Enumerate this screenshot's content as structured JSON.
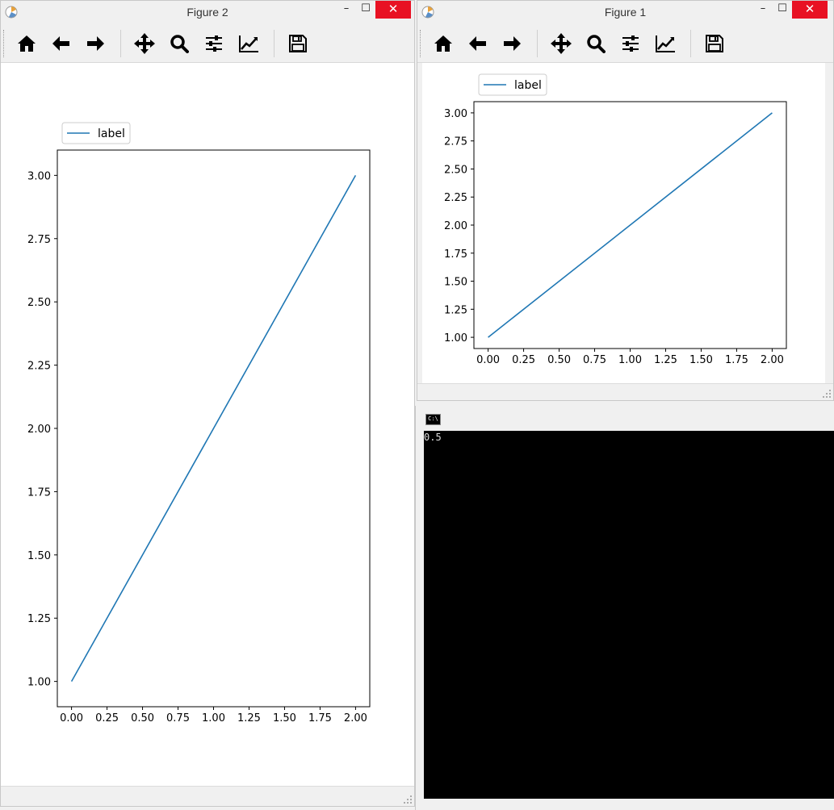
{
  "windows": {
    "figure2": {
      "title": "Figure 2",
      "minimize": "–",
      "maximize": "☐",
      "close": "✕",
      "legend_label": "label"
    },
    "figure1": {
      "title": "Figure 1",
      "minimize": "–",
      "maximize": "☐",
      "close": "✕",
      "legend_label": "label"
    }
  },
  "toolbar": {
    "buttons": [
      "home-icon",
      "back-arrow-icon",
      "forward-arrow-icon",
      "pan-icon",
      "zoom-icon",
      "subplots-config-icon",
      "edit-axes-icon",
      "save-icon"
    ]
  },
  "console": {
    "output": "0.5"
  },
  "colors": {
    "line": "#1f77b4",
    "close_button": "#e81123",
    "console_bg": "#000000"
  },
  "chart_data": [
    {
      "type": "line",
      "window": "Figure 2",
      "series": [
        {
          "name": "label",
          "x": [
            0,
            2
          ],
          "y": [
            1,
            3
          ]
        }
      ],
      "xticks": [
        "0.00",
        "0.25",
        "0.50",
        "0.75",
        "1.00",
        "1.25",
        "1.50",
        "1.75",
        "2.00"
      ],
      "yticks": [
        "1.00",
        "1.25",
        "1.50",
        "1.75",
        "2.00",
        "2.25",
        "2.50",
        "2.75",
        "3.00"
      ],
      "xlim": [
        -0.1,
        2.1
      ],
      "ylim": [
        0.9,
        3.1
      ],
      "legend": "outside-top-left",
      "grid": false
    },
    {
      "type": "line",
      "window": "Figure 1",
      "series": [
        {
          "name": "label",
          "x": [
            0,
            2
          ],
          "y": [
            1,
            3
          ]
        }
      ],
      "xticks": [
        "0.00",
        "0.25",
        "0.50",
        "0.75",
        "1.00",
        "1.25",
        "1.50",
        "1.75",
        "2.00"
      ],
      "yticks": [
        "1.00",
        "1.25",
        "1.50",
        "1.75",
        "2.00",
        "2.25",
        "2.50",
        "2.75",
        "3.00"
      ],
      "xlim": [
        -0.1,
        2.1
      ],
      "ylim": [
        0.9,
        3.1
      ],
      "legend": "outside-top-left",
      "grid": false
    }
  ]
}
